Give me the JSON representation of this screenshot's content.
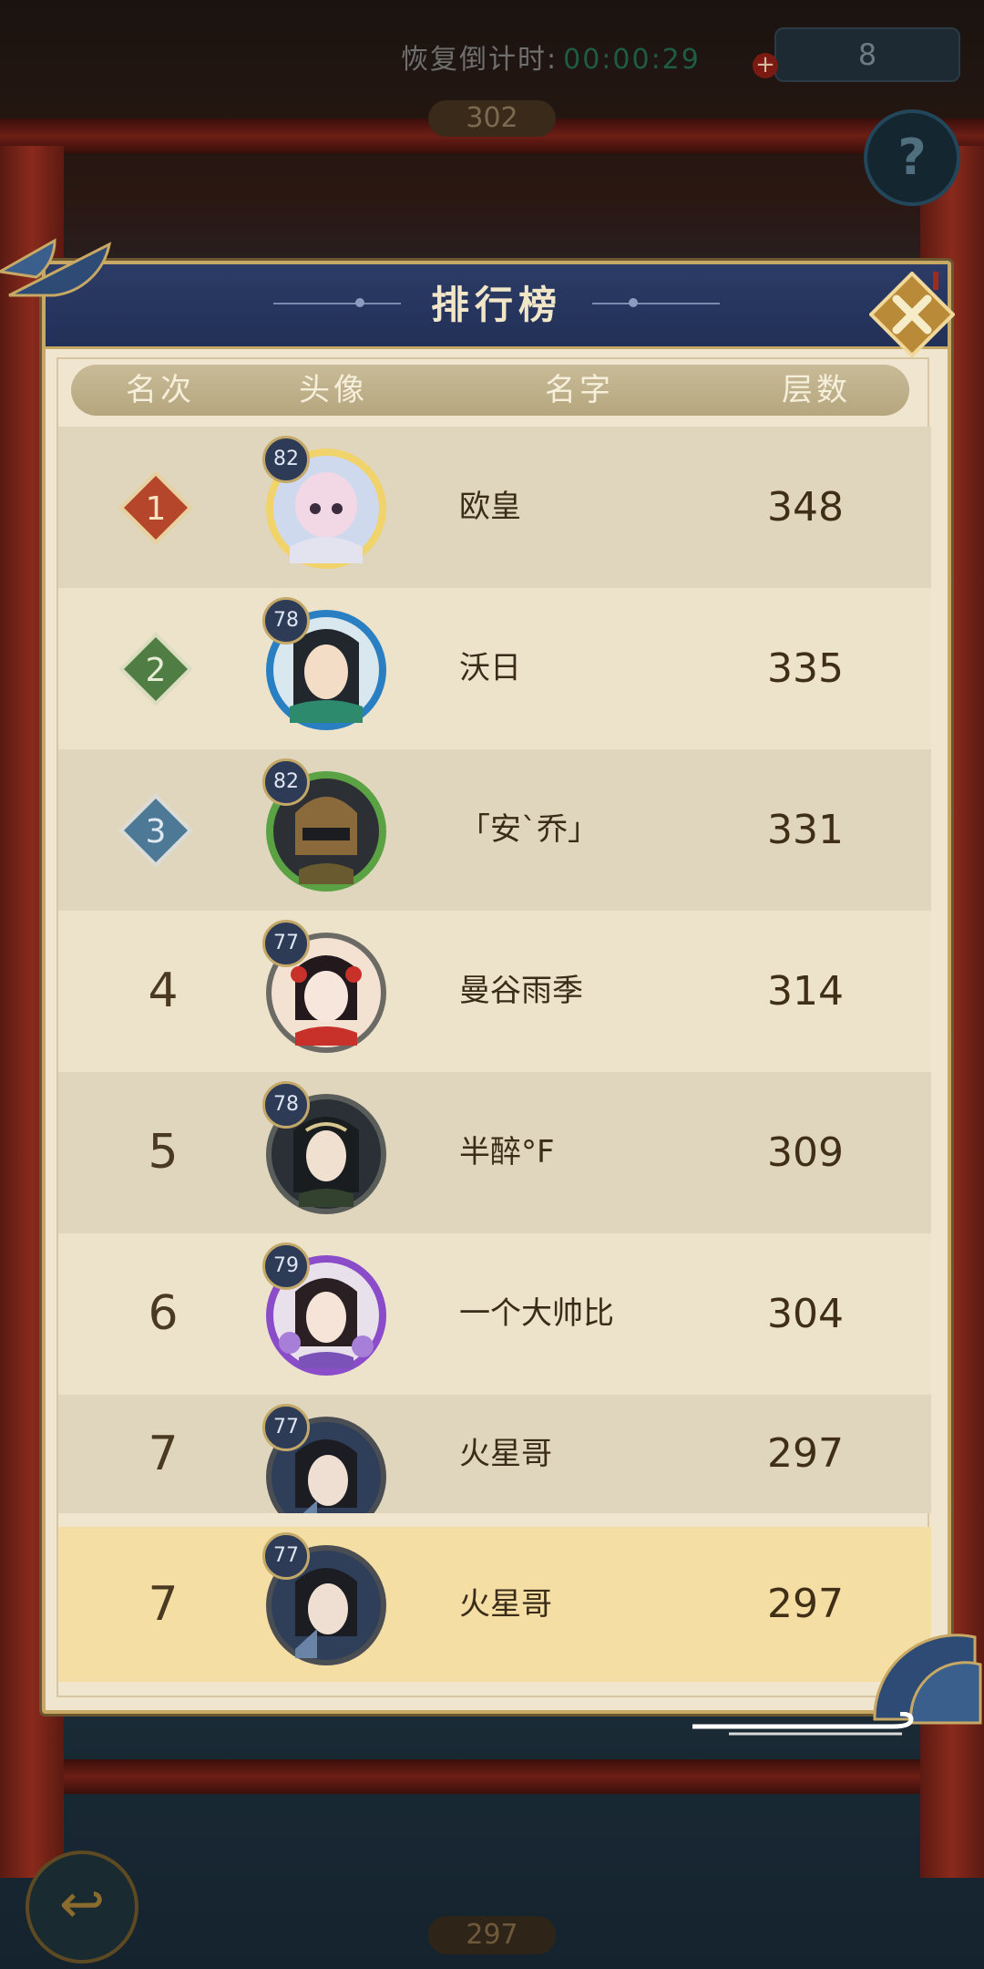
{
  "top_bar": {
    "timer_label": "恢复倒计时:",
    "timer_value": "00:00:29",
    "resource_count": "8",
    "floor_current": "302",
    "help_label": "?"
  },
  "panel": {
    "title": "排行榜",
    "columns": {
      "rank": "名次",
      "avatar": "头像",
      "name": "名字",
      "floors": "层数"
    },
    "rows": [
      {
        "rank": "1",
        "level": "82",
        "name": "欧皇",
        "score": "348",
        "badge": "#b5462b"
      },
      {
        "rank": "2",
        "level": "78",
        "name": "沃日",
        "score": "335",
        "badge": "#4f7d43"
      },
      {
        "rank": "3",
        "level": "82",
        "name": "「安`乔」",
        "score": "331",
        "badge": "#4d7896"
      },
      {
        "rank": "4",
        "level": "77",
        "name": "曼谷雨季",
        "score": "314"
      },
      {
        "rank": "5",
        "level": "78",
        "name": "半醉°F",
        "score": "309"
      },
      {
        "rank": "6",
        "level": "79",
        "name": "一个大帅比",
        "score": "304"
      },
      {
        "rank": "7",
        "level": "77",
        "name": "火星哥",
        "score": "297"
      }
    ],
    "self_row": {
      "rank": "7",
      "level": "77",
      "name": "火星哥",
      "score": "297"
    }
  },
  "bottom_bar": {
    "floor_bottom": "297"
  },
  "colors": {
    "panel_border": "#c8a865",
    "header_blue": "#2c3c66",
    "self_highlight": "#f4dea3"
  }
}
